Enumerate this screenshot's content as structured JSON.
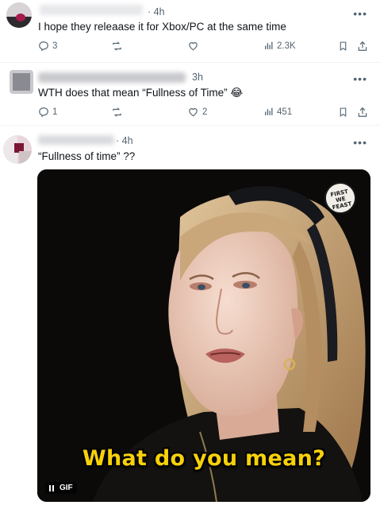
{
  "replies": [
    {
      "time": "· 4h",
      "text": "I hope they releaase it for Xbox/PC at the same time",
      "stats": {
        "replies": "3",
        "reposts": "",
        "likes": "",
        "views": "2.3K"
      }
    },
    {
      "time": "3h",
      "text": "WTH does that mean “Fullness of Time” 😂",
      "stats": {
        "replies": "1",
        "reposts": "",
        "likes": "2",
        "views": "451"
      }
    },
    {
      "time": "· 4h",
      "text": "“Fullness of time” ??",
      "gif": {
        "caption": "What do you mean?",
        "badge": "GIF",
        "logo_line1": "FIRST",
        "logo_line2": "WE",
        "logo_line3": "FEAST"
      }
    }
  ],
  "icons": {
    "more": "more-horizontal-icon",
    "reply": "reply-icon",
    "repost": "repost-icon",
    "like": "heart-icon",
    "views": "views-icon",
    "bookmark": "bookmark-icon",
    "share": "share-icon"
  },
  "colors": {
    "text": "#0f1419",
    "muted": "#536471",
    "caption": "#f7d10a"
  }
}
